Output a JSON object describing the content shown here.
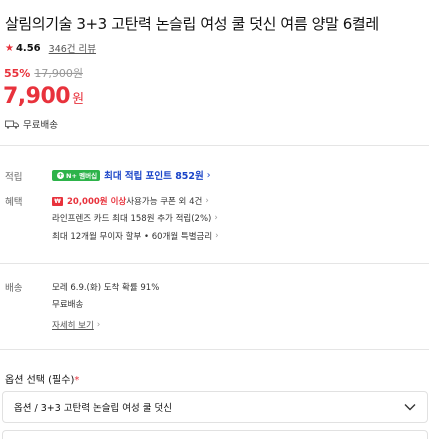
{
  "product": {
    "title": "살림의기술 3+3 고탄력 논슬립 여성 쿨 덧신 여름 양말 6켤레",
    "rating": "4.56",
    "reviews": "346건 리뷰",
    "discount": "55%",
    "original_price": "17,900원",
    "price": "7,900",
    "currency": "원",
    "shipping": "무료배송"
  },
  "benefits": {
    "points_label": "적립",
    "npay_badge": "N+ 멤버십",
    "points_text": "최대 적립 포인트 852원",
    "benefit_label": "혜택",
    "coupon_amount": "20,000원 이상",
    "coupon_text": " 사용가능 쿠폰 외 4건",
    "card_text": "라인프렌즈 카드 최대 158원 추가 적립(2%)",
    "installment_text": "최대 12개월 무이자 할부 • 60개월 특별금리"
  },
  "delivery": {
    "label": "배송",
    "arrival": "모레 6.9.(화) 도착 확률 91%",
    "fee": "무료배송",
    "detail_link": "자세히 보기"
  },
  "options": {
    "label": "옵션 선택 (필수)",
    "required_mark": "*",
    "selected": "옵션 / 3+3 고탄력 논슬립 여성 쿨 덧신"
  },
  "icons": {
    "star": "star-icon",
    "truck": "truck-icon",
    "coupon": "coupon-icon",
    "chevron": "chevron-right-icon",
    "dropdown": "chevron-down-icon"
  },
  "colors": {
    "accent_red": "#e8323c",
    "points_blue": "#1a44c8",
    "npay_green": "#2db34a"
  }
}
